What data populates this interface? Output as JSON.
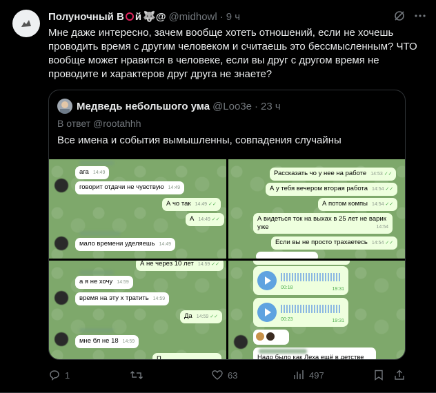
{
  "tweet": {
    "author_name": "Полуночный В",
    "author_name_tail": "й",
    "author_emoji": "🐺@",
    "handle": "@midhowl",
    "sep": "·",
    "time": "9 ч",
    "text": "Мне даже интересно, зачем вообще хотеть отношений, если не хочешь проводить время с другим человеком и считаешь это бессмысленным? ЧТО вообще может нравится в человеке, если вы друг с другом время не проводите и характеров друг друга не знаете?"
  },
  "quote": {
    "author_name": "Медведь небольшого ума",
    "handle": "@Loo3e",
    "sep": "·",
    "time": "23 ч",
    "reply_to": "В ответ @rootahhh",
    "text": "Все имена и события вымышленны, совпадения случайны"
  },
  "panels": {
    "p1": {
      "m1": "ага",
      "m1t": "14:49",
      "m2": "говорит отдачи не чувствую",
      "m2t": "14:49",
      "m3": "А чо так",
      "m3t": "14:49",
      "m4": "А",
      "m4t": "14:49",
      "m5": "мало времени уделяешь",
      "m5t": "14:49"
    },
    "p2": {
      "m1": "Рассказать чо у нее на работе",
      "m1t": "14:53",
      "m2": "А у тебя вечером вторая работа",
      "m2t": "14:54",
      "m3": "А потом компы",
      "m3t": "14:54",
      "m4a": "А видеться ток на выхах в 25 лет не варик",
      "m4b": "уже",
      "m4t": "14:54",
      "m5": "Если вы не просто трахаетесь",
      "m5t": "14:54"
    },
    "p3": {
      "m0": "А не через 10 лет",
      "m0t": "14:59",
      "m1": "а я не хочу",
      "m1t": "14:59",
      "m2": "время на эту х тратить",
      "m2t": "14:59",
      "m3": "Да",
      "m3t": "14:59",
      "m4": "мне бл не 18",
      "m4t": "14:59",
      "m5": "П"
    },
    "p4": {
      "v1len": "00:18",
      "v1t": "19:31",
      "v2len": "00:23",
      "v2t": "19:31",
      "m3": "Надо было как Леха ещё в детстве"
    }
  },
  "actions": {
    "reply_count": "1",
    "retweet_count": "",
    "like_count": "63",
    "views_count": "497"
  }
}
